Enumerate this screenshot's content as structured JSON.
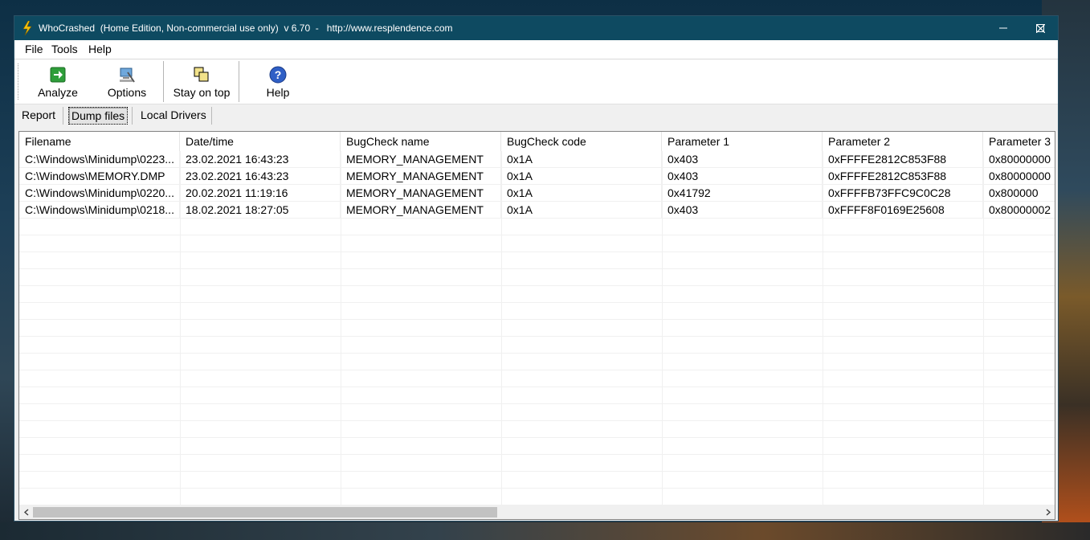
{
  "window": {
    "title": "WhoCrashed  (Home Edition, Non-commercial use only)  v 6.70  -   http://www.resplendence.com"
  },
  "menu": [
    "File",
    "Tools",
    "Help"
  ],
  "toolbar": {
    "analyze": "Analyze",
    "options": "Options",
    "stay_on_top": "Stay on top",
    "help": "Help"
  },
  "tabs": [
    "Report",
    "Dump files",
    "Local Drivers"
  ],
  "active_tab": "Dump files",
  "table": {
    "columns": [
      "Filename",
      "Date/time",
      "BugCheck name",
      "BugCheck code",
      "Parameter 1",
      "Parameter 2",
      "Parameter 3"
    ],
    "rows": [
      [
        "C:\\Windows\\Minidump\\0223...",
        "23.02.2021 16:43:23",
        "MEMORY_MANAGEMENT",
        "0x1A",
        "0x403",
        "0xFFFFE2812C853F88",
        "0x80000000"
      ],
      [
        "C:\\Windows\\MEMORY.DMP",
        "23.02.2021 16:43:23",
        "MEMORY_MANAGEMENT",
        "0x1A",
        "0x403",
        "0xFFFFE2812C853F88",
        "0x80000000"
      ],
      [
        "C:\\Windows\\Minidump\\0220...",
        "20.02.2021 11:19:16",
        "MEMORY_MANAGEMENT",
        "0x1A",
        "0x41792",
        "0xFFFFB73FFC9C0C28",
        "0x800000"
      ],
      [
        "C:\\Windows\\Minidump\\0218...",
        "18.02.2021 18:27:05",
        "MEMORY_MANAGEMENT",
        "0x1A",
        "0x403",
        "0xFFFF8F0169E25608",
        "0x80000002"
      ]
    ]
  },
  "colors": {
    "titlebar": "#0e4a61",
    "grid_line": "#f0f0f0"
  },
  "icons": {
    "app": "lightning-icon",
    "analyze": "green-arrow-icon",
    "options": "computer-settings-icon",
    "stay_on_top": "stacked-windows-icon",
    "help": "question-circle-icon"
  }
}
